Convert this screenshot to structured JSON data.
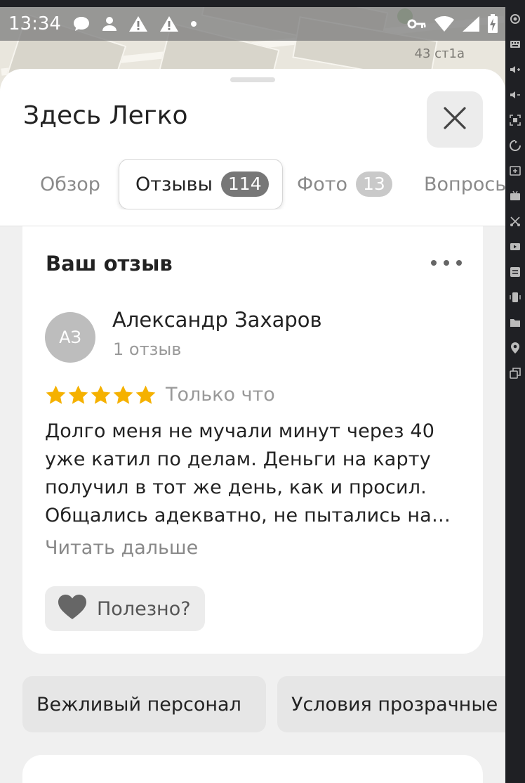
{
  "status_bar": {
    "time": "13:34",
    "icons_left": [
      "chat-icon",
      "person-icon",
      "warning-icon",
      "warning-icon",
      "dot-icon"
    ],
    "icons_right": [
      "key-icon",
      "wifi-icon",
      "signal-icon",
      "battery-charging-icon"
    ]
  },
  "map": {
    "address_label": "43 ст1а"
  },
  "place": {
    "title": "Здесь Легко"
  },
  "tabs": [
    {
      "label": "Обзор",
      "badge": ""
    },
    {
      "label": "Отзывы",
      "badge": "114",
      "active": true
    },
    {
      "label": "Фото",
      "badge": "13"
    },
    {
      "label": "Вопросы",
      "badge": ""
    }
  ],
  "review_card": {
    "heading": "Ваш отзыв",
    "avatar_initials": "АЗ",
    "author_name": "Александр Захаров",
    "author_reviews": "1 отзыв",
    "rating": 5,
    "rating_max": 5,
    "time": "Только что",
    "text_lines": [
      "Долго меня не мучали минут через 40",
      "уже катил по делам. Деньги на карту",
      "получил в тот же день, как и просил.",
      "Общались адекватно, не пытались на…"
    ],
    "read_more": "Читать дальше",
    "useful_label": "Полезно?"
  },
  "chips": [
    "Вежливый персонал",
    "Условия прозрачные"
  ],
  "colors": {
    "star": "#f5b100",
    "sheet_bg": "#f0f0f0",
    "card_bg": "#ffffff",
    "badge_active": "#777777",
    "badge_inactive": "#c9c9c9"
  },
  "side_tools": [
    "camera-icon",
    "keyboard-icon",
    "volume-up-icon",
    "volume-down-icon",
    "screenshot-icon",
    "rotate-icon",
    "add-window-icon",
    "apk-icon",
    "cut-icon",
    "video-icon",
    "swap-icon",
    "vibrate-icon",
    "folder-icon",
    "location-icon",
    "multi-window-icon"
  ]
}
